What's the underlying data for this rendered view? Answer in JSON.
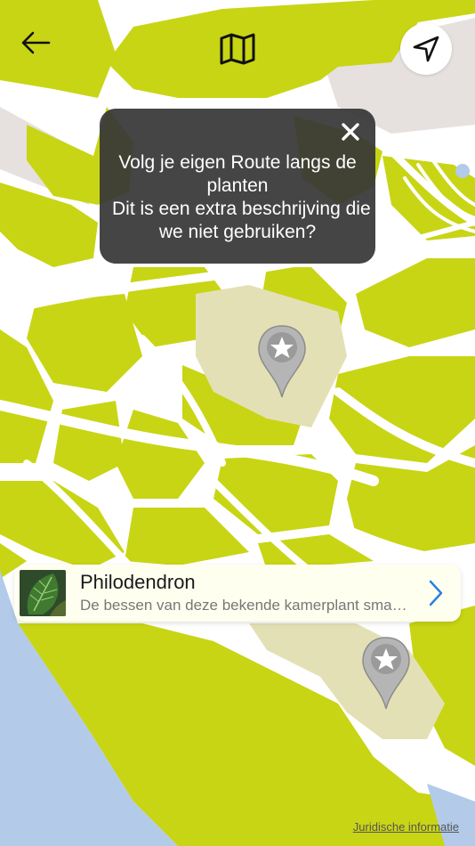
{
  "header": {
    "back_icon": "arrow-left-icon",
    "map_icon": "folded-map-icon",
    "locate_icon": "navigation-arrow-icon"
  },
  "popup": {
    "lines": [
      "Volg je eigen Route langs de",
      "planten",
      "Dit is een extra beschrijving die",
      "we niet gebruiken?"
    ],
    "close_icon": "close-icon"
  },
  "map": {
    "markers": [
      {
        "icon": "star-marker-icon"
      },
      {
        "icon": "star-marker-icon"
      }
    ],
    "colors": {
      "grass": "#c8d514",
      "path": "#ffffff",
      "water": "#b3cbe9",
      "plaza": "#e4e0b6",
      "building": "#e6e1df"
    }
  },
  "plant_card": {
    "title": "Philodendron",
    "description": "De bessen van deze bekende kamerplant smaken naar ananas",
    "chevron_icon": "chevron-right-icon",
    "accent": "#2c7fe0"
  },
  "footer": {
    "legal_link": "Juridische informatie"
  }
}
